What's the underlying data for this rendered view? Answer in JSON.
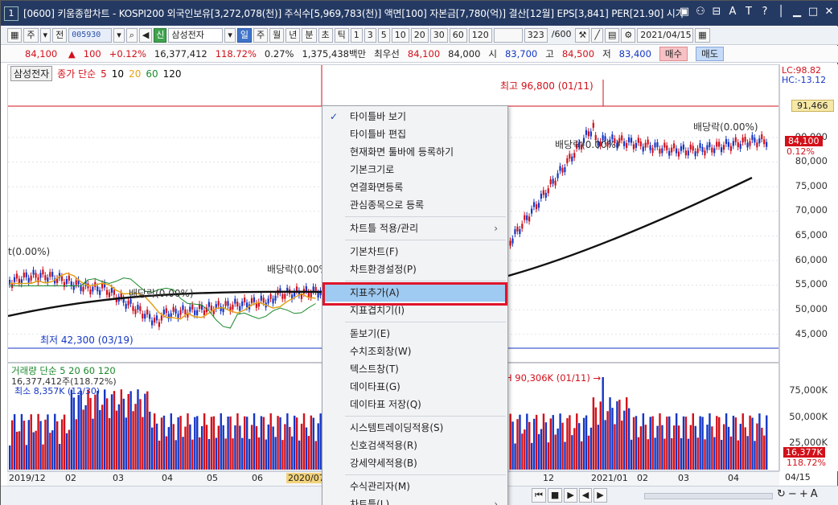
{
  "window": {
    "number": "1",
    "title": "[0600] 키움종합차트 - KOSPI200 외국인보유[3,272,078(천)] 주식수[5,969,783(천)] 액면[100] 자본금[7,780(억)] 결산[12월] EPS[3,841] PER[21.90] 시가"
  },
  "toolbar": {
    "market": "주",
    "scope": "전",
    "code": "005930",
    "credit_badge": "신",
    "stock_name": "삼성전자",
    "periods": [
      "일",
      "주",
      "월",
      "년",
      "분",
      "초",
      "틱"
    ],
    "active_period": "일",
    "intervals": [
      "1",
      "3",
      "5",
      "10",
      "20",
      "30",
      "60",
      "120"
    ],
    "count": "323",
    "count_max": "/600",
    "date": "2021/04/15"
  },
  "quote": {
    "price": "84,100",
    "change": "100",
    "change_pct": "+0.12%",
    "volume": "16,377,412",
    "volume_ratio": "118.72%",
    "turnover_pct": "0.27%",
    "amount": "1,375,438백만",
    "seller_label": "최우선",
    "best_ask": "84,100",
    "best_bid": "84,000",
    "open_label": "시",
    "open": "83,700",
    "high_label": "고",
    "high": "84,500",
    "low_label": "저",
    "low": "83,400",
    "buy_label": "매수",
    "sell_label": "매도"
  },
  "legend": {
    "name": "삼성전자",
    "series": "종가 단순",
    "ma": [
      {
        "period": "5",
        "color": "#d2101a"
      },
      {
        "period": "10",
        "color": "#000000"
      },
      {
        "period": "20",
        "color": "#e3a21a"
      },
      {
        "period": "60",
        "color": "#1c8a2c"
      },
      {
        "period": "120",
        "color": "#111111"
      }
    ]
  },
  "annotations": {
    "max_label": "최고 96,800 (01/11)",
    "min_label": "최저 42,300 (03/19)",
    "dividend_1": "배당락(0.00%)",
    "dividend_2": "배당락(0.00%)",
    "dividend_3": "배당락(0.00%)",
    "dividend_4": "배당락(0.00%)",
    "dividend_5": "배당락(0.00%)",
    "dividend_1_short": "t(0.00%)"
  },
  "price_axis": {
    "lc": "LC:98.82",
    "hc": "HC:-13.12",
    "ticks": [
      "90,000",
      "85,000",
      "80,000",
      "75,000",
      "70,000",
      "65,000",
      "60,000",
      "55,000",
      "50,000",
      "45,000"
    ],
    "current_box": "91,466",
    "current_price_tag": "84,100",
    "current_pct_tag": "0.12%",
    "grid_color": "#e0e3e8"
  },
  "volume_panel": {
    "title": "거래량 단순",
    "ma": [
      "5",
      "20",
      "60",
      "120"
    ],
    "value": "16,377,412주(118.72%)",
    "min_label": "최소 8,357K (12/30)",
    "max_label": "H 90,306K (01/11)",
    "ticks": [
      "75,000K",
      "50,000K",
      "25,000K"
    ],
    "tag_value": "16,377K",
    "tag_pct": "118.72%"
  },
  "time_axis": {
    "labels": [
      "2019/12",
      "02",
      "03",
      "04",
      "05",
      "06",
      "2020/07",
      "12",
      "2021/01",
      "02",
      "03",
      "04",
      "04/15"
    ]
  },
  "context_menu": {
    "items": [
      {
        "label": "타이틀바 보기",
        "checked": true
      },
      {
        "label": "타이틀바 편집"
      },
      {
        "label": "현재화면 툴바에 등록하기"
      },
      {
        "label": "기본크기로"
      },
      {
        "label": "연결화면등록"
      },
      {
        "label": "관심종목으로 등록"
      },
      {
        "label": "차트틀 적용/관리",
        "submenu": true
      },
      {
        "label": "기본차트(F)"
      },
      {
        "label": "차트환경설정(P)"
      },
      {
        "label": "지표추가(A)",
        "selected": true
      },
      {
        "label": "지표겹치기(I)"
      },
      {
        "label": "돋보기(E)"
      },
      {
        "label": "수치조회창(W)"
      },
      {
        "label": "텍스트창(T)"
      },
      {
        "label": "데이타표(G)"
      },
      {
        "label": "데이타표 저장(Q)"
      },
      {
        "label": "시스템트레이딩적용(S)"
      },
      {
        "label": "신호검색적용(R)"
      },
      {
        "label": "강세약세적용(B)"
      },
      {
        "label": "수식관리자(M)"
      },
      {
        "label": "차트틀(L)",
        "submenu": true
      }
    ]
  },
  "colors": {
    "title_bg": "#253a63",
    "up": "#d2101a",
    "down": "#1437c4",
    "highlight_border": "#e0142a",
    "selected_bg": "#9fcaf2"
  }
}
